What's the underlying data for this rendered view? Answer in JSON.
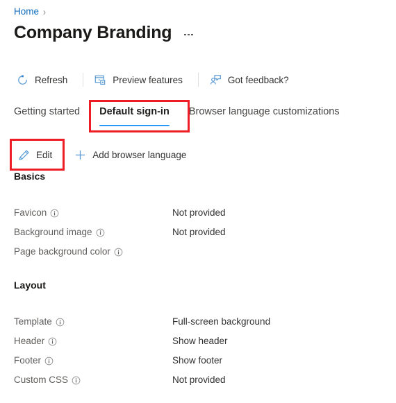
{
  "breadcrumb": {
    "home_label": "Home",
    "separator": "›"
  },
  "header": {
    "title": "Company Branding",
    "more_menu_name": "more-options"
  },
  "commandbar": {
    "buttons": [
      {
        "label": "Refresh",
        "icon": "refresh-icon"
      },
      {
        "label": "Preview features",
        "icon": "preview-features-icon"
      },
      {
        "label": "Got feedback?",
        "icon": "feedback-icon"
      }
    ]
  },
  "pivot": {
    "tabs": [
      {
        "label": "Getting started",
        "selected": false
      },
      {
        "label": "Default sign-in",
        "selected": true
      },
      {
        "label": "Browser language customizations",
        "selected": false
      }
    ]
  },
  "actionbar": {
    "edit_label": "Edit",
    "add_language_label": "Add browser language"
  },
  "sections": [
    {
      "heading": "Basics",
      "rows": [
        {
          "label": "Favicon",
          "value": "Not provided"
        },
        {
          "label": "Background image",
          "value": "Not provided"
        },
        {
          "label": "Page background color",
          "value": ""
        }
      ]
    },
    {
      "heading": "Layout",
      "rows": [
        {
          "label": "Template",
          "value": "Full-screen background"
        },
        {
          "label": "Header",
          "value": "Show header"
        },
        {
          "label": "Footer",
          "value": "Show footer"
        },
        {
          "label": "Custom CSS",
          "value": "Not provided"
        }
      ]
    }
  ],
  "colors": {
    "link": "#0f6cbd",
    "accent": "#2899f5",
    "icon": "#5b9bd5",
    "annotation": "#ee1c25",
    "label_text": "#605e5c",
    "value_text": "#323130"
  }
}
